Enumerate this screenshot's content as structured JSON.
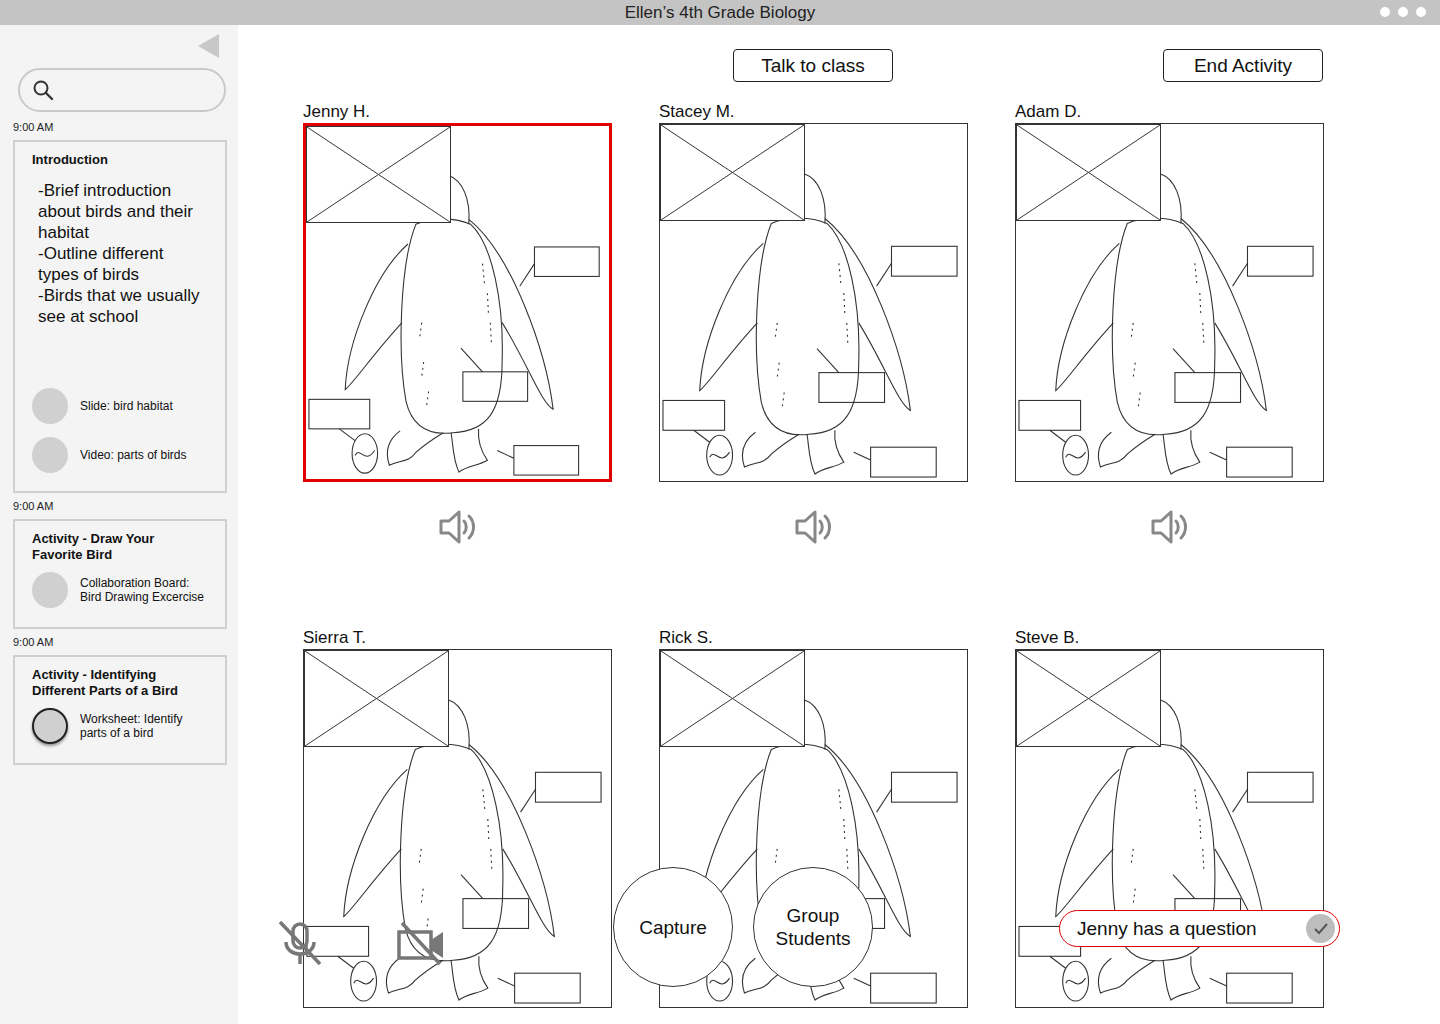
{
  "window": {
    "title": "Ellen’s 4th Grade Biology"
  },
  "sidebar": {
    "sessions": [
      {
        "time": "9:00 AM",
        "title": "Introduction",
        "notes": [
          "-Brief introduction about birds and their habitat",
          "-Outline different types of birds",
          "-Birds that we usually see at school"
        ],
        "resources": [
          {
            "label": "Slide: bird habitat",
            "active": false
          },
          {
            "label": "Video: parts of birds",
            "active": false
          }
        ]
      },
      {
        "time": "9:00 AM",
        "title": "Activity - Draw Your Favorite Bird",
        "notes": [],
        "resources": [
          {
            "label": "Collaboration Board: Bird Drawing Excercise",
            "active": false
          }
        ]
      },
      {
        "time": "9:00 AM",
        "title": "Activity - Identifying Different Parts of a Bird",
        "notes": [],
        "resources": [
          {
            "label": "Worksheet: Identify parts of a bird",
            "active": true
          }
        ]
      }
    ]
  },
  "toolbar": {
    "buttons": [
      "Talk to class",
      "End Activity"
    ]
  },
  "students": [
    {
      "name": "Jenny H.",
      "selected": true
    },
    {
      "name": "Stacey M.",
      "selected": false
    },
    {
      "name": "Adam D.",
      "selected": false
    },
    {
      "name": "Sierra T.",
      "selected": false
    },
    {
      "name": "Rick S.",
      "selected": false
    },
    {
      "name": "Steve B.",
      "selected": false
    }
  ],
  "controls": {
    "mic_muted": true,
    "camera_off": true,
    "actions": [
      "Capture",
      "Group Students"
    ]
  },
  "notification": {
    "text": "Jenny has a question",
    "acknowledged": true
  }
}
